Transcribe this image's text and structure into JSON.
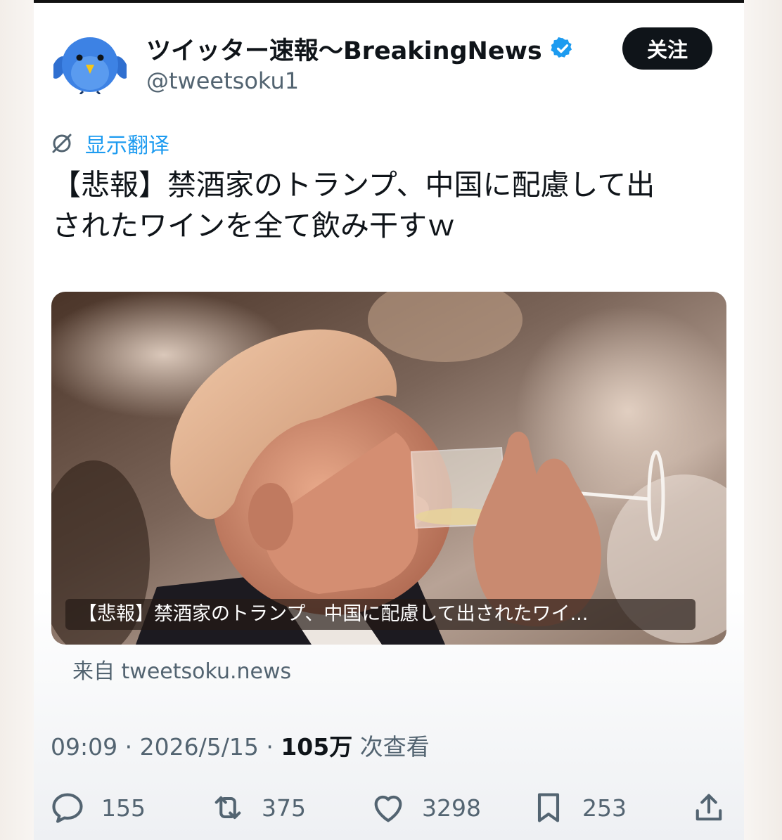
{
  "author": {
    "display_name": "ツイッター速報〜BreakingNews",
    "handle": "@tweetsoku1",
    "follow_label": "关注"
  },
  "translate_label": "显示翻译",
  "tweet": {
    "text_line1": "【悲報】禁酒家のトランプ、中国に配慮して出",
    "text_line2": "されたワインを全て飲み干すｗ"
  },
  "media": {
    "caption": "【悲報】禁酒家のトランプ、中国に配慮して出されたワイ...",
    "source": "来自 tweetsoku.news"
  },
  "meta": {
    "time": "09:09",
    "date": "2026/5/15",
    "views_count": "105万",
    "views_label": "次查看",
    "separator": "·"
  },
  "actions": {
    "replies": "155",
    "reposts": "375",
    "likes": "3298",
    "bookmarks": "253"
  },
  "colors": {
    "accent": "#1d9bf0",
    "text": "#0f1419",
    "secondary": "#536471",
    "follow_bg": "#0f1419"
  }
}
